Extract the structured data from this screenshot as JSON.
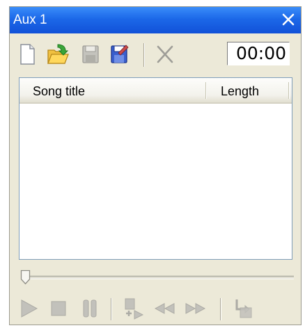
{
  "window": {
    "title": "Aux 1",
    "time_display": "00:00"
  },
  "toolbar": {
    "buttons": [
      "new-document-icon",
      "open-folder-icon",
      "save-icon",
      "save-as-icon",
      "delete-x-icon"
    ]
  },
  "playlist": {
    "columns": [
      "Song title",
      "Length"
    ],
    "rows": []
  },
  "transport": {
    "buttons": [
      "play-icon",
      "stop-icon",
      "pause-icon",
      "add-to-queue-icon",
      "rewind-icon",
      "fast-forward-icon",
      "return-icon"
    ],
    "state": "disabled"
  },
  "position_slider": {
    "value": 0
  },
  "colors": {
    "titlebar": "#1c68e8",
    "window_bg": "#ece9d8",
    "disabled_icon": "#b3b2ad"
  }
}
